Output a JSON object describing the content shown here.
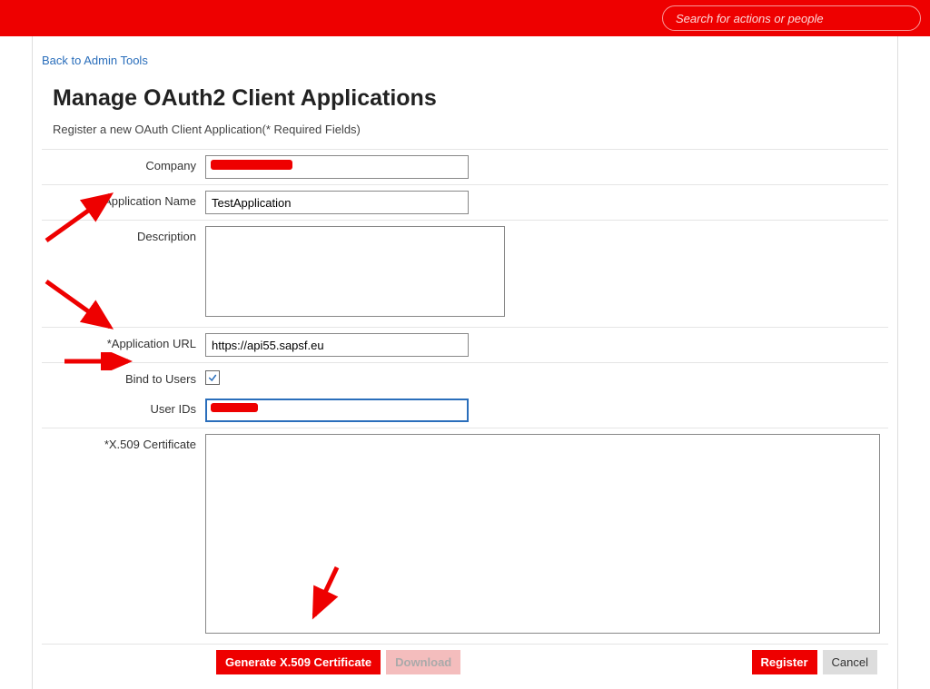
{
  "header": {
    "search_placeholder": "Search for actions or people"
  },
  "nav": {
    "back_link": "Back to Admin Tools"
  },
  "page": {
    "title": "Manage OAuth2 Client Applications",
    "subtitle": "Register a new OAuth Client Application(* Required Fields)"
  },
  "form": {
    "company": {
      "label": "Company",
      "value": ""
    },
    "app_name": {
      "label": "*Application Name",
      "value": "TestApplication"
    },
    "description": {
      "label": "Description",
      "value": ""
    },
    "app_url": {
      "label": "*Application URL",
      "value": "https://api55.sapsf.eu"
    },
    "bind_users": {
      "label": "Bind to Users",
      "checked": true
    },
    "user_ids": {
      "label": "User IDs",
      "value": ""
    },
    "certificate": {
      "label": "*X.509 Certificate",
      "value": ""
    }
  },
  "buttons": {
    "generate": "Generate X.509 Certificate",
    "download": "Download",
    "register": "Register",
    "cancel": "Cancel"
  }
}
